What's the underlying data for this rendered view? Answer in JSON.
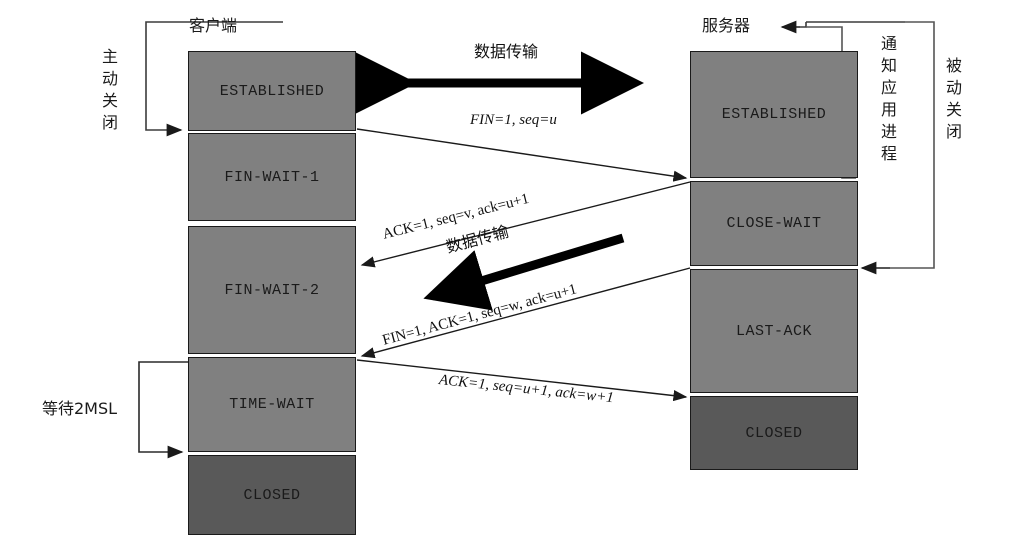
{
  "diagram": {
    "title_client": "客户端",
    "title_server": "服务器",
    "active_close_label": "主动关闭",
    "passive_close_label": "被动关闭",
    "notify_app_label": "通知应用进程",
    "wait_2msl_label": "等待2MSL",
    "data_transfer_label_top": "数据传输",
    "data_transfer_label_mid": "数据传输"
  },
  "client_states": [
    {
      "name": "ESTABLISHED",
      "closed": false
    },
    {
      "name": "FIN-WAIT-1",
      "closed": false
    },
    {
      "name": "FIN-WAIT-2",
      "closed": false
    },
    {
      "name": "TIME-WAIT",
      "closed": false
    },
    {
      "name": "CLOSED",
      "closed": true
    }
  ],
  "server_states": [
    {
      "name": "ESTABLISHED",
      "closed": false
    },
    {
      "name": "CLOSE-WAIT",
      "closed": false
    },
    {
      "name": "LAST-ACK",
      "closed": false
    },
    {
      "name": "CLOSED",
      "closed": true
    }
  ],
  "messages": [
    {
      "id": "msg1",
      "text": "FIN=1,  seq=u",
      "direction": "client-to-server"
    },
    {
      "id": "msg2",
      "text": "ACK=1, seq=v, ack=u+1",
      "direction": "server-to-client"
    },
    {
      "id": "msg3",
      "text": "FIN=1,  ACK=1,  seq=w, ack=u+1",
      "direction": "server-to-client"
    },
    {
      "id": "msg4",
      "text": "ACK=1, seq=u+1, ack=w+1",
      "direction": "client-to-server"
    }
  ],
  "colors": {
    "state_fill": "#808080",
    "closed_fill": "#595959",
    "line": "#1a1a1a",
    "bracket": "#555555",
    "background": "#ffffff"
  }
}
